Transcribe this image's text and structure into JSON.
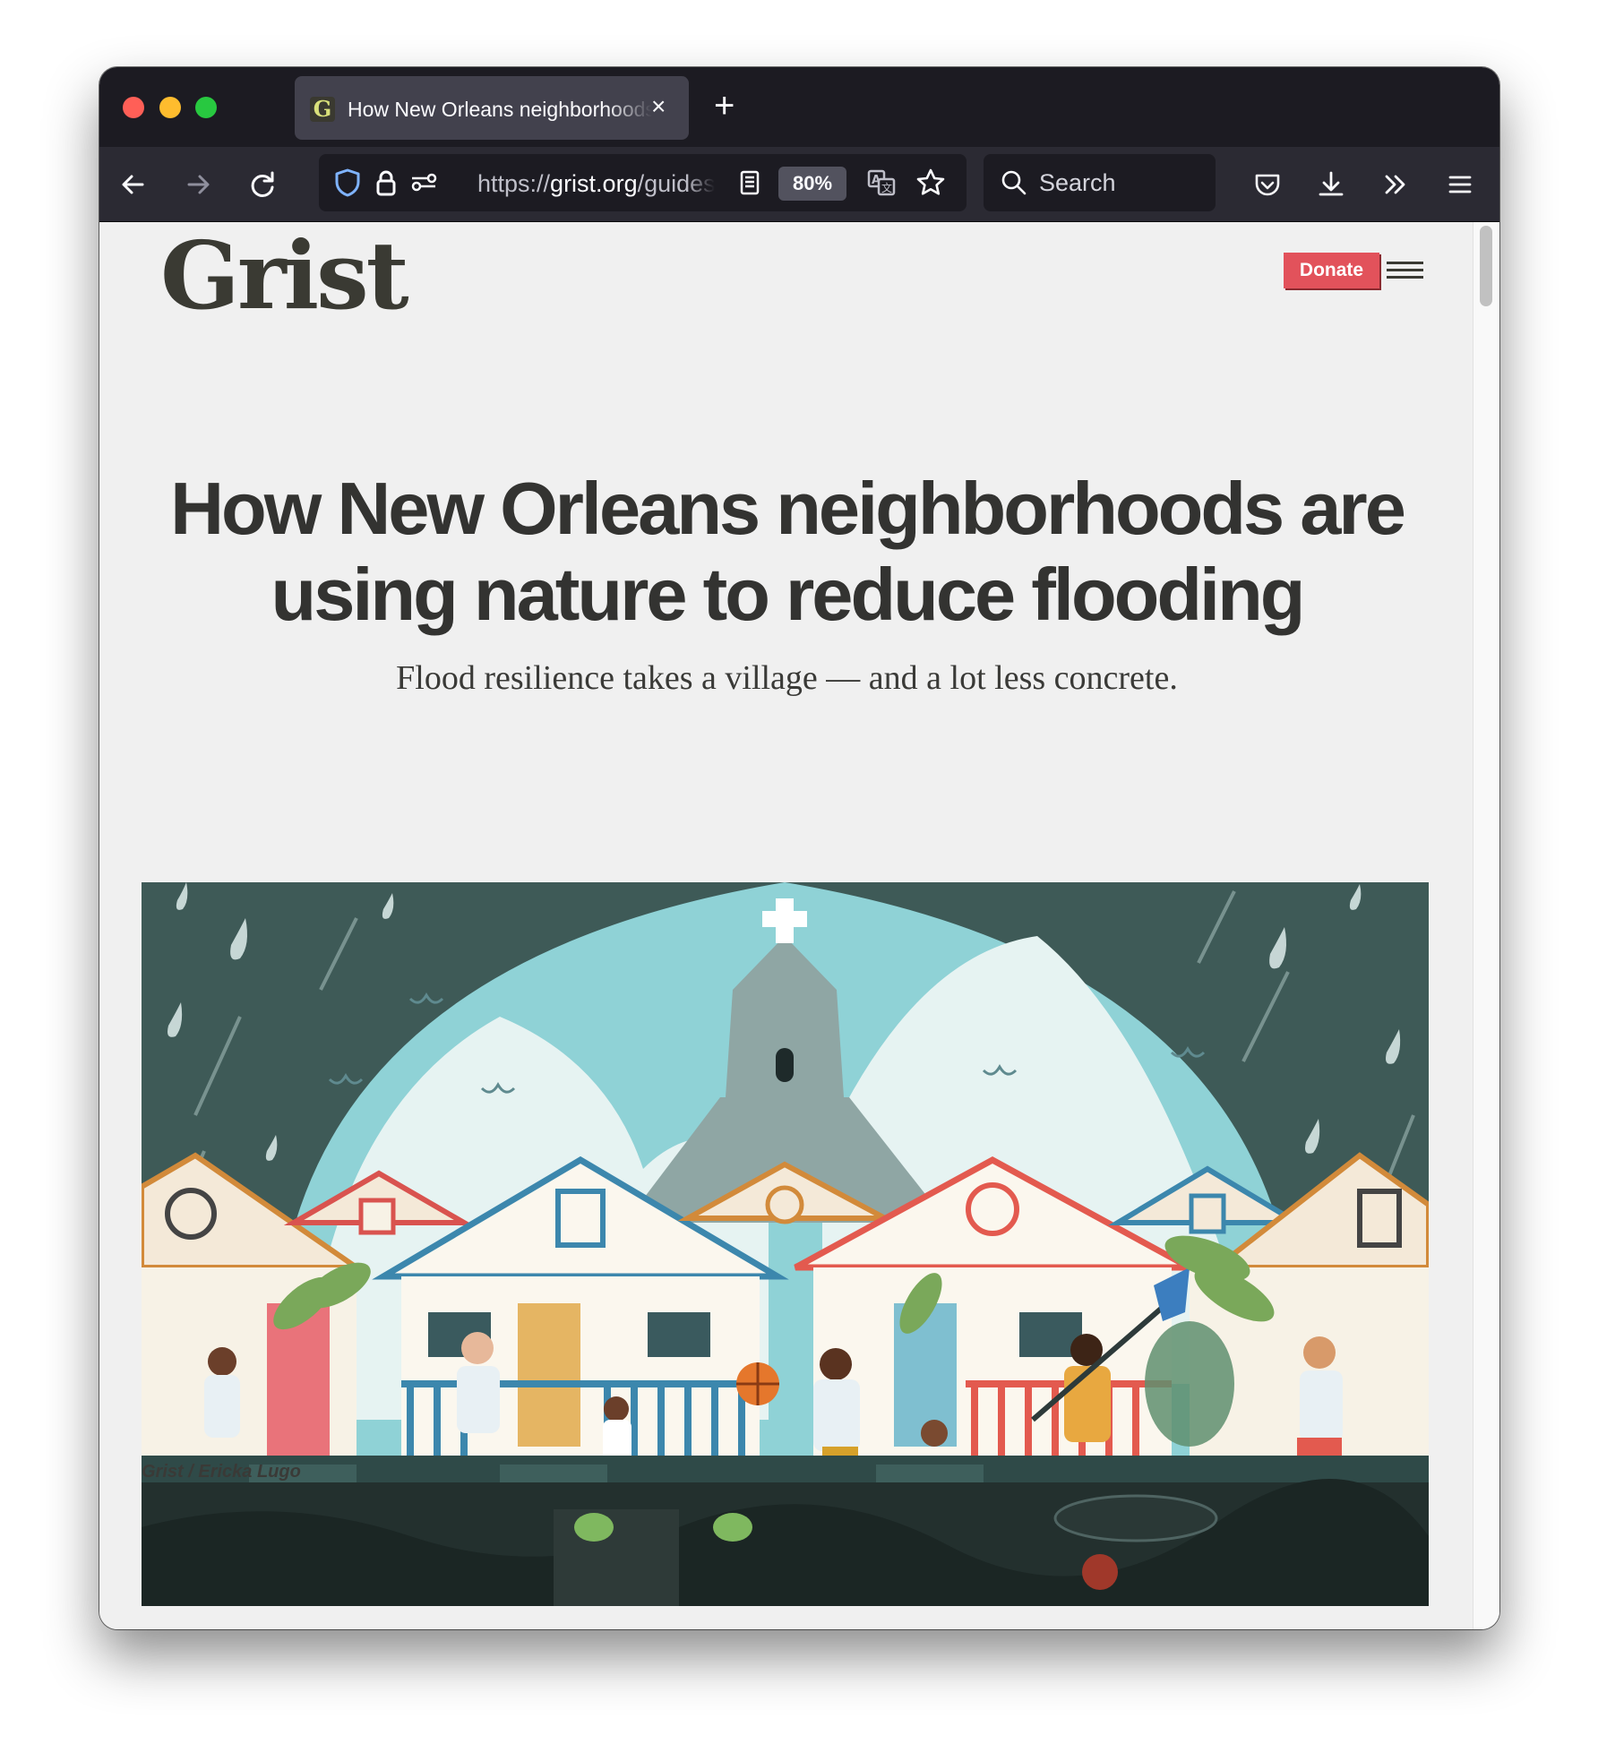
{
  "browser": {
    "tab_title": "How New Orleans neighborhoods are using nature to reduce flooding",
    "tab_favicon_letter": "G",
    "url_prefix": "https://",
    "url_host": "grist.org",
    "url_path": "/guides/",
    "zoom_level": "80%",
    "search_placeholder": "Search"
  },
  "site": {
    "logo_text": "Grist",
    "donate_label": "Donate"
  },
  "article": {
    "headline_line1": "How New Orleans neighborhoods are",
    "headline_line2": "using nature to reduce flooding",
    "dek": "Flood resilience takes a village — and a lot less concrete.",
    "image_credit": "Grist / Ericka Lugo"
  },
  "colors": {
    "accent_red": "#e2525b",
    "text_dark": "#333331",
    "page_bg": "#f0f0f0",
    "browser_chrome": "#1c1b22"
  },
  "icons": [
    "back-arrow-icon",
    "forward-arrow-icon",
    "reload-icon",
    "shield-icon",
    "lock-icon",
    "permissions-icon",
    "reader-view-icon",
    "translate-icon",
    "bookmark-star-icon",
    "search-icon",
    "pocket-icon",
    "download-icon",
    "overflow-chevron-icon",
    "app-menu-icon",
    "hamburger-menu-icon"
  ]
}
